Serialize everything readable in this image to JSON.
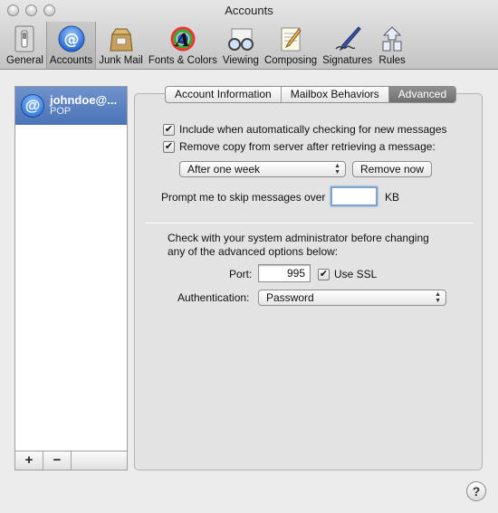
{
  "window": {
    "title": "Accounts"
  },
  "toolbar": {
    "items": [
      {
        "label": "General",
        "icon": "switch-icon"
      },
      {
        "label": "Accounts",
        "icon": "at-sign-icon"
      },
      {
        "label": "Junk Mail",
        "icon": "junk-mail-bag-icon"
      },
      {
        "label": "Fonts & Colors",
        "icon": "font-color-icon"
      },
      {
        "label": "Viewing",
        "icon": "glasses-icon"
      },
      {
        "label": "Composing",
        "icon": "notepad-pencil-icon"
      },
      {
        "label": "Signatures",
        "icon": "pen-signature-icon"
      },
      {
        "label": "Rules",
        "icon": "rules-arrows-icon"
      }
    ],
    "selected": "Accounts"
  },
  "sidebar": {
    "accounts": [
      {
        "name": "johndoe@...",
        "type": "POP"
      }
    ],
    "add_label": "+",
    "remove_label": "−"
  },
  "tabs": [
    {
      "label": "Account Information"
    },
    {
      "label": "Mailbox Behaviors"
    },
    {
      "label": "Advanced"
    }
  ],
  "active_tab": "Advanced",
  "advanced": {
    "include_auto_check": {
      "label": "Include when automatically checking for new messages",
      "checked": true
    },
    "remove_copy": {
      "label": "Remove copy from server after retrieving a message:",
      "checked": true
    },
    "remove_after": {
      "value": "After one week"
    },
    "remove_now_label": "Remove now",
    "prompt_label": "Prompt me to skip messages over",
    "prompt_value": "",
    "prompt_unit": "KB",
    "admin_note_line1": "Check with your system administrator before changing",
    "admin_note_line2": "any of the advanced options below:",
    "port_label": "Port:",
    "port_value": "995",
    "use_ssl": {
      "label": "Use SSL",
      "checked": true
    },
    "auth_label": "Authentication:",
    "auth_value": "Password"
  },
  "help_label": "?",
  "colors": {
    "selection": "#4b73b7",
    "accent": "#1d64d0"
  }
}
